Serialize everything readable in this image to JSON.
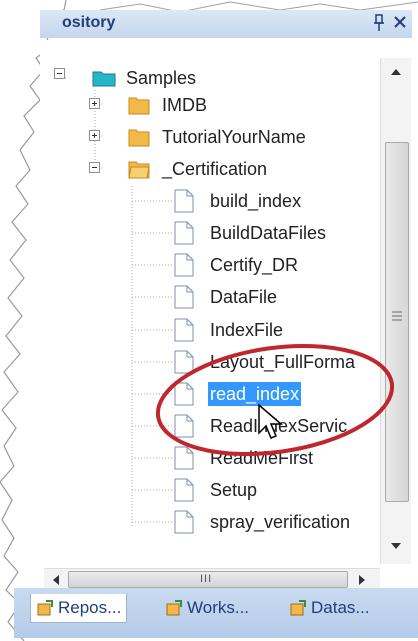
{
  "panel": {
    "title": "ository"
  },
  "tree": {
    "root": {
      "label": "Samples"
    },
    "folders": [
      {
        "label": "IMDB",
        "expanded": false
      },
      {
        "label": "TutorialYourName",
        "expanded": false
      },
      {
        "label": "_Certification",
        "expanded": true
      }
    ],
    "files": [
      {
        "label": "build_index"
      },
      {
        "label": "BuildDataFiles"
      },
      {
        "label": "Certify_DR"
      },
      {
        "label": "DataFile"
      },
      {
        "label": "IndexFile"
      },
      {
        "label": "Layout_FullForma"
      },
      {
        "label": "read_index",
        "selected": true
      },
      {
        "label": "ReadIndexServic"
      },
      {
        "label": "ReadMeFirst"
      },
      {
        "label": "Setup"
      },
      {
        "label": "spray_verification"
      }
    ]
  },
  "scrollbar": {
    "h_grip": "III"
  },
  "tabs": [
    {
      "label": "Repos...",
      "active": true
    },
    {
      "label": "Works...",
      "active": false
    },
    {
      "label": "Datas...",
      "active": false
    }
  ],
  "colors": {
    "selection": "#3399ff",
    "annotation": "#c0262d",
    "folder": "#f3b84a",
    "root_folder": "#26b6c7"
  }
}
